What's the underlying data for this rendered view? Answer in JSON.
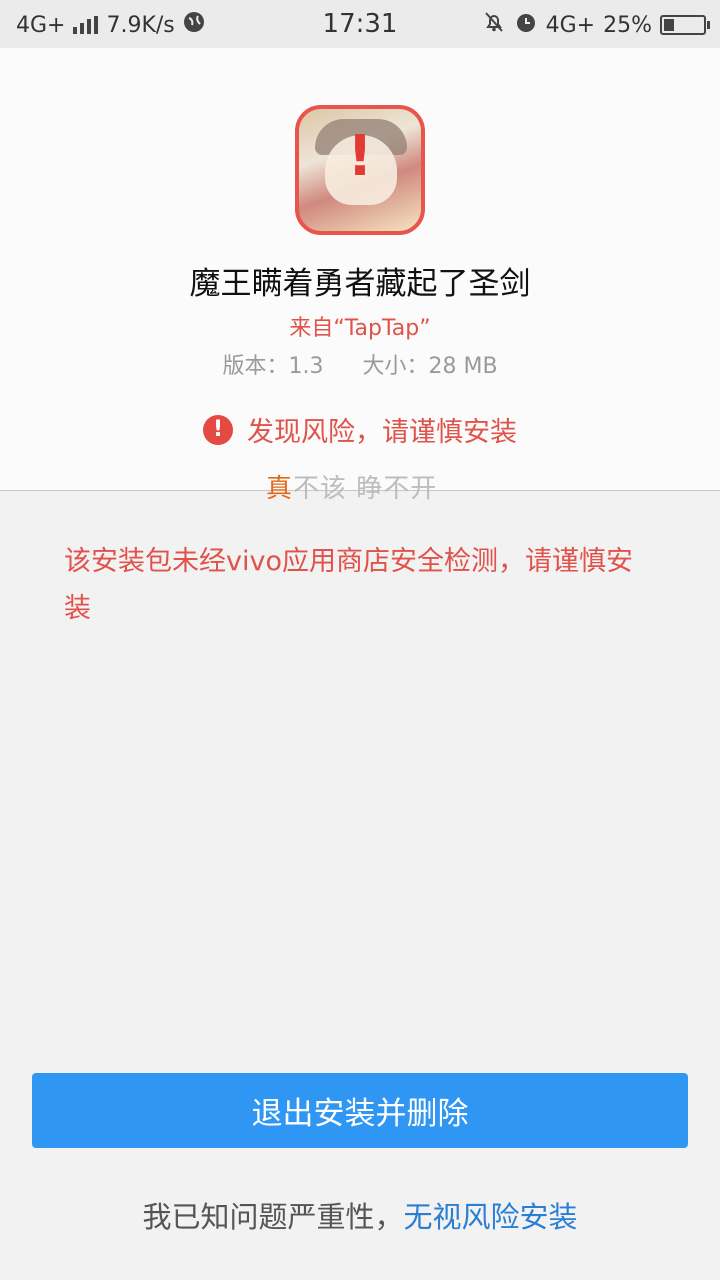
{
  "status_bar": {
    "network_left": "4G+",
    "speed": "7.9K/s",
    "time": "17:31",
    "network_right": "4G+",
    "battery_percent": "25%",
    "battery_level": 0.25
  },
  "app": {
    "name": "魔王瞒着勇者藏起了圣剑",
    "source": "来自“TapTap”",
    "version": "版本：1.3",
    "size": "大小：28 MB",
    "risk_title": "发现风险，请谨慎安装",
    "icon_mark": "!"
  },
  "overlay": {
    "highlight": "真",
    "rest": "不该 睁不开"
  },
  "warning_text": "该安装包未经vivo应用商店安全检测，请谨慎安装",
  "buttons": {
    "exit_delete": "退出安装并删除",
    "ack_text": "我已知问题严重性，",
    "ignore_install": "无视风险安装"
  },
  "colors": {
    "danger": "#e0524a",
    "primary": "#2f96f3",
    "link": "#2a7fd4"
  }
}
